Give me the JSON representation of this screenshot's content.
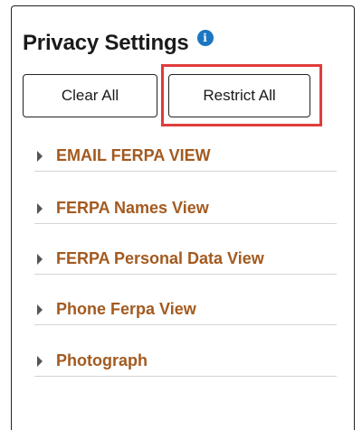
{
  "panel": {
    "title": "Privacy Settings",
    "info_icon": "info-icon"
  },
  "buttons": {
    "clear_all": "Clear All",
    "restrict_all": "Restrict All"
  },
  "sections": [
    {
      "label": "EMAIL FERPA VIEW",
      "icon": "caret-right-icon"
    },
    {
      "label": "FERPA Names View",
      "icon": "caret-right-icon"
    },
    {
      "label": "FERPA Personal Data View",
      "icon": "caret-right-icon"
    },
    {
      "label": "Phone Ferpa View",
      "icon": "caret-right-icon"
    },
    {
      "label": "Photograph",
      "icon": "caret-right-icon"
    }
  ],
  "colors": {
    "section_label": "#a35a1f",
    "info_icon": "#1b76c2",
    "highlight": "#e03c3c"
  }
}
